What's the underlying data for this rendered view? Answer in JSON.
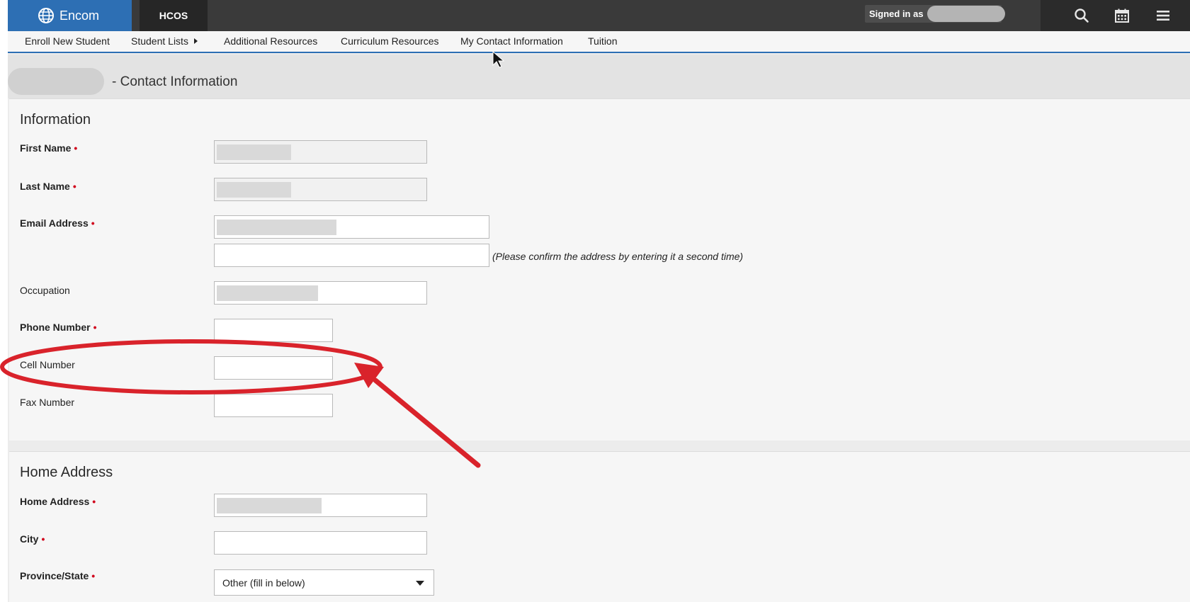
{
  "header": {
    "brand_name": "Encom",
    "tab": "HCOS",
    "signed_in_label": "Signed in as",
    "icons": [
      "search-icon",
      "calendar-icon",
      "menu-icon"
    ],
    "brand_color": "#2d6fb4"
  },
  "nav": {
    "items": [
      {
        "label": "Enroll New Student"
      },
      {
        "label": "Student Lists"
      },
      {
        "label": "Additional Resources"
      },
      {
        "label": "Curriculum Resources"
      },
      {
        "label": "My Contact Information"
      },
      {
        "label": "Tuition"
      }
    ]
  },
  "page_title": "- Contact Information",
  "info": {
    "heading": "Information",
    "first_name": "First Name",
    "last_name": "Last Name",
    "email": "Email Address",
    "confirm_note": "(Please confirm the address by entering it a second time)",
    "occupation": "Occupation",
    "phone": "Phone Number",
    "cell": "Cell Number",
    "fax": "Fax Number",
    "required_mark": "•"
  },
  "home": {
    "heading": "Home Address",
    "home_address": "Home Address",
    "city": "City",
    "province": "Province/State",
    "province_value": "Other (fill in below)"
  },
  "annotation_color": "#d9232b"
}
